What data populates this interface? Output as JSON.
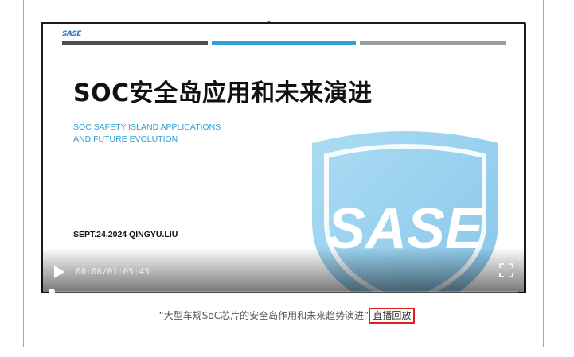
{
  "slide": {
    "logo_text": "SASE",
    "title": "SOC安全岛应用和未来演进",
    "subtitle_line1": "SOC SAFETY ISLAND APPLICATIONS",
    "subtitle_line2": "AND FUTURE EVOLUTION",
    "date_author": "SEPT.24.2024   QINGYU.LIU",
    "watermark_text": "SASE"
  },
  "player": {
    "time_display": "00:06/01:05:43",
    "progress_fraction": 0.0015,
    "play_icon": "play-icon",
    "fullscreen_icon": "fullscreen-icon"
  },
  "caption": {
    "quote": "“大型车规SoC芯片的安全岛作用和未来趋势演进”",
    "highlight": "直播回放"
  },
  "colors": {
    "accent_blue": "#2f9fd8",
    "highlight_border": "#e02020"
  }
}
